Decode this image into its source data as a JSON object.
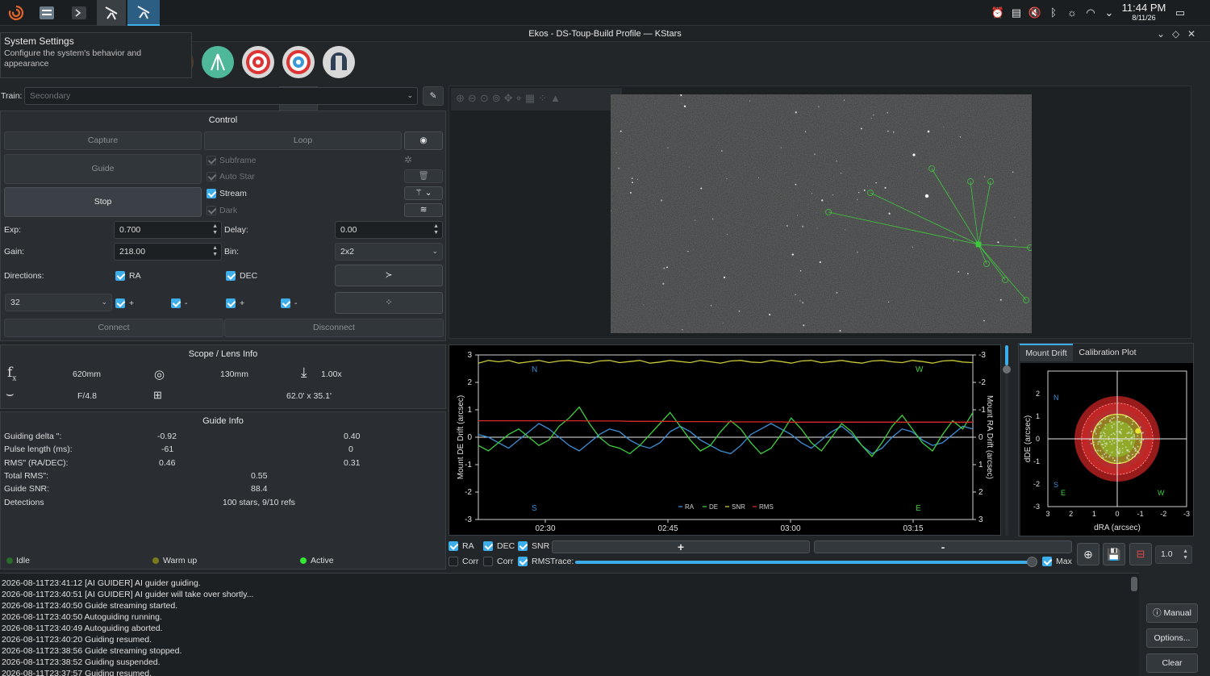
{
  "taskbar": {
    "time": "11:44 PM",
    "date": "8/11/26"
  },
  "window": {
    "title": "Ekos - DS-Toup-Build Profile — KStars"
  },
  "tooltip": {
    "title": "System Settings",
    "body": "Configure the system's behavior and appearance"
  },
  "train": {
    "label": "Train:",
    "value": "Secondary"
  },
  "control": {
    "title": "Control",
    "capture": "Capture",
    "loop": "Loop",
    "guide": "Guide",
    "stop": "Stop",
    "subframe": "Subframe",
    "auto_star": "Auto Star",
    "stream": "Stream",
    "dark": "Dark",
    "exp_label": "Exp:",
    "exp_value": "0.700",
    "delay_label": "Delay:",
    "delay_value": "0.00",
    "gain_label": "Gain:",
    "gain_value": "218.00",
    "bin_label": "Bin:",
    "bin_value": "2x2",
    "directions_label": "Directions:",
    "ra": "RA",
    "dec": "DEC",
    "box_value": "32",
    "plus": "+",
    "minus": "-",
    "connect": "Connect",
    "disconnect": "Disconnect"
  },
  "scope": {
    "title": "Scope / Lens Info",
    "focal_length": "620mm",
    "aperture": "130mm",
    "reducer": "1.00x",
    "focal_ratio": "F/4.8",
    "fov": "62.0' x 35.1'"
  },
  "guide_info": {
    "title": "Guide Info",
    "rows": [
      {
        "label": "Guiding delta \":",
        "a": "-0.92",
        "b": "0.40"
      },
      {
        "label": "Pulse length (ms):",
        "a": "-61",
        "b": "0"
      },
      {
        "label": "RMS\" (RA/DEC):",
        "a": "0.46",
        "b": "0.31"
      }
    ],
    "total_rms_label": "Total RMS\":",
    "total_rms": "0.55",
    "snr_label": "Guide SNR:",
    "snr": "88.4",
    "detections_label": "Detections",
    "detections": "100 stars, 9/10 refs"
  },
  "status": {
    "idle": "Idle",
    "warmup": "Warm up",
    "active": "Active",
    "colors": {
      "idle": "#2b6b2b",
      "warmup": "#7a7a1a",
      "active": "#33e633"
    }
  },
  "chart_data": [
    {
      "type": "line",
      "ylabel": "Mount DE Drift (arcsec)",
      "y2label": "Mount RA Drift (arcsec)",
      "ylim": [
        -3,
        3
      ],
      "y2lim": [
        3,
        -3
      ],
      "yticks": [
        "3",
        "2",
        "1",
        "0",
        "-1",
        "-2",
        "-3"
      ],
      "y2ticks": [
        "-3",
        "-2",
        "-1",
        "0",
        "1",
        "2",
        "3"
      ],
      "xticks": [
        "02:30",
        "02:45",
        "03:00",
        "03:15"
      ],
      "corner_labels": {
        "n": "N",
        "w": "W",
        "s": "S",
        "e": "E"
      },
      "legend": [
        "RA",
        "DE",
        "SNR",
        "RMS"
      ],
      "series": [
        {
          "name": "RA",
          "color": "#3d8fd6",
          "values": [
            0.1,
            0.0,
            -0.2,
            -0.4,
            -0.1,
            0.2,
            0.5,
            0.3,
            0.0,
            -0.3,
            -0.5,
            -0.2,
            0.1,
            0.3,
            0.2,
            -0.1,
            -0.3,
            -0.4,
            -0.2,
            0.2,
            0.4,
            0.2,
            -0.1,
            -0.3,
            -0.5,
            -0.6,
            -0.3,
            0.1,
            0.3,
            0.5,
            0.3,
            0.1,
            -0.2,
            -0.4,
            -0.1,
            0.2,
            0.4,
            0.1,
            -0.3,
            -0.6,
            -0.4,
            0.0,
            0.3,
            0.2,
            -0.1,
            -0.3,
            -0.2,
            0.1,
            0.4,
            0.3
          ]
        },
        {
          "name": "DE",
          "color": "#3ecf3e",
          "values": [
            -0.3,
            -0.5,
            -0.2,
            0.1,
            0.3,
            0.0,
            -0.3,
            -0.1,
            0.4,
            0.7,
            1.1,
            0.5,
            0.0,
            -0.3,
            -0.4,
            -0.6,
            -0.3,
            0.1,
            0.5,
            0.9,
            0.4,
            -0.1,
            -0.5,
            -0.3,
            0.2,
            0.6,
            0.3,
            -0.2,
            -0.6,
            -0.4,
            0.1,
            0.7,
            0.3,
            -0.2,
            -0.5,
            0.0,
            0.5,
            0.2,
            -0.3,
            -0.7,
            -0.2,
            0.4,
            0.8,
            0.3,
            -0.2,
            -0.5,
            0.1,
            0.6,
            0.3,
            0.9
          ]
        },
        {
          "name": "SNR",
          "color": "#c8c83a",
          "values": [
            2.7,
            2.8,
            2.75,
            2.8,
            2.7,
            2.75,
            2.8,
            2.72,
            2.78,
            2.8,
            2.74,
            2.7,
            2.78,
            2.8,
            2.72,
            2.76,
            2.8,
            2.7,
            2.74,
            2.8,
            2.76,
            2.72,
            2.8,
            2.75,
            2.7,
            2.78,
            2.8,
            2.74,
            2.72,
            2.8,
            2.76,
            2.7,
            2.78,
            2.8,
            2.72,
            2.76,
            2.8,
            2.74,
            2.7,
            2.78,
            2.8,
            2.75,
            2.72,
            2.8,
            2.76,
            2.7,
            2.78,
            2.8,
            2.74,
            2.72
          ]
        },
        {
          "name": "RMS",
          "color": "#d92a2a",
          "values": [
            0.6,
            0.6,
            0.6,
            0.6,
            0.6,
            0.6,
            0.6,
            0.6,
            0.6,
            0.6,
            0.6,
            0.59,
            0.59,
            0.59,
            0.59,
            0.58,
            0.58,
            0.58,
            0.58,
            0.58,
            0.57,
            0.57,
            0.57,
            0.57,
            0.57,
            0.56,
            0.56,
            0.56,
            0.56,
            0.56,
            0.56,
            0.55,
            0.55,
            0.55,
            0.55,
            0.55,
            0.55,
            0.55,
            0.55,
            0.55,
            0.55,
            0.55,
            0.55,
            0.55,
            0.55,
            0.55,
            0.55,
            0.55,
            0.55,
            0.55
          ]
        }
      ]
    },
    {
      "type": "scatter",
      "xlabel": "dRA (arcsec)",
      "ylabel": "dDE (arcsec)",
      "xlim": [
        3,
        -3
      ],
      "ylim": [
        -3,
        3
      ],
      "xticks": [
        "3",
        "2",
        "1",
        "0",
        "-1",
        "-2",
        "-3"
      ],
      "yticks": [
        "2",
        "1",
        "0",
        "-1",
        "-2",
        "-3"
      ],
      "corner_labels": {
        "n": "N",
        "s": "S",
        "e": "E",
        "w": "W"
      },
      "current": {
        "x": -0.9,
        "y": 0.35
      }
    }
  ],
  "drift_tabs": [
    "Mount Drift",
    "Calibration Plot"
  ],
  "graph_controls": {
    "ra": "RA",
    "dec": "DEC",
    "snr": "SNR",
    "corr1": "Corr",
    "corr2": "Corr",
    "rms": "RMS",
    "trace": "Trace:",
    "plus": "+",
    "minus": "-",
    "max": "Max",
    "zoom_value": "1.0"
  },
  "log": {
    "lines": [
      "2026-08-11T23:41:12 [AI GUIDER] AI guider guiding.",
      "2026-08-11T23:40:51 [AI GUIDER] AI guider will take over shortly...",
      "2026-08-11T23:40:50 Guide streaming started.",
      "2026-08-11T23:40:50 Autoguiding running.",
      "2026-08-11T23:40:49 Autoguiding aborted.",
      "2026-08-11T23:40:20 Guiding resumed.",
      "2026-08-11T23:38:56 Guide streaming stopped.",
      "2026-08-11T23:38:52 Guiding suspended.",
      "2026-08-11T23:37:57 Guiding resumed."
    ]
  },
  "side_buttons": {
    "manual": "Manual",
    "options": "Options...",
    "clear": "Clear"
  }
}
